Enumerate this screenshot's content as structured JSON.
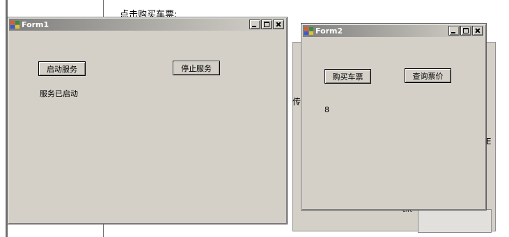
{
  "background": {
    "doc_text": "点击购买车票:",
    "snip_partial": "传",
    "snip_right": "E",
    "snip_ent": "ent"
  },
  "form1": {
    "title": "Form1",
    "start_button": "启动服务",
    "stop_button": "停止服务",
    "status_label": "服务已启动"
  },
  "form2": {
    "title": "Form2",
    "buy_button": "购买车票",
    "query_button": "查询票价",
    "count_label": "8"
  },
  "colors": {
    "window_face": "#d4d0c8",
    "titlebar_dark": "#808080",
    "titlebar_light": "#d6d3cc"
  }
}
